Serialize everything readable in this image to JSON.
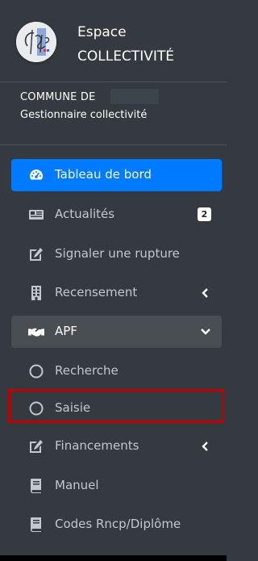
{
  "brand": {
    "line1": "Espace",
    "line2": "COLLECTIVITÉ",
    "logo_icon": "chips-logo"
  },
  "user": {
    "commune_label": "COMMUNE DE",
    "role": "Gestionnaire collectivité"
  },
  "nav": {
    "items": [
      {
        "label": "Tableau de bord",
        "icon": "tachometer-icon"
      },
      {
        "label": "Actualités",
        "icon": "newspaper-icon",
        "badge": "2"
      },
      {
        "label": "Signaler une rupture",
        "icon": "edit-icon"
      },
      {
        "label": "Recensement",
        "icon": "building-icon"
      },
      {
        "label": "APF",
        "icon": "handshake-icon"
      },
      {
        "label": "Recherche",
        "icon": "circle-icon"
      },
      {
        "label": "Saisie",
        "icon": "circle-icon"
      },
      {
        "label": "Financements",
        "icon": "edit-icon"
      },
      {
        "label": "Manuel",
        "icon": "book-icon"
      },
      {
        "label": "Codes Rncp/Diplôme",
        "icon": "book-icon"
      }
    ]
  },
  "colors": {
    "sidebar_bg": "#343a40",
    "active_bg": "#007bff",
    "open_bg": "#494e53",
    "highlight_border": "#c00000"
  }
}
